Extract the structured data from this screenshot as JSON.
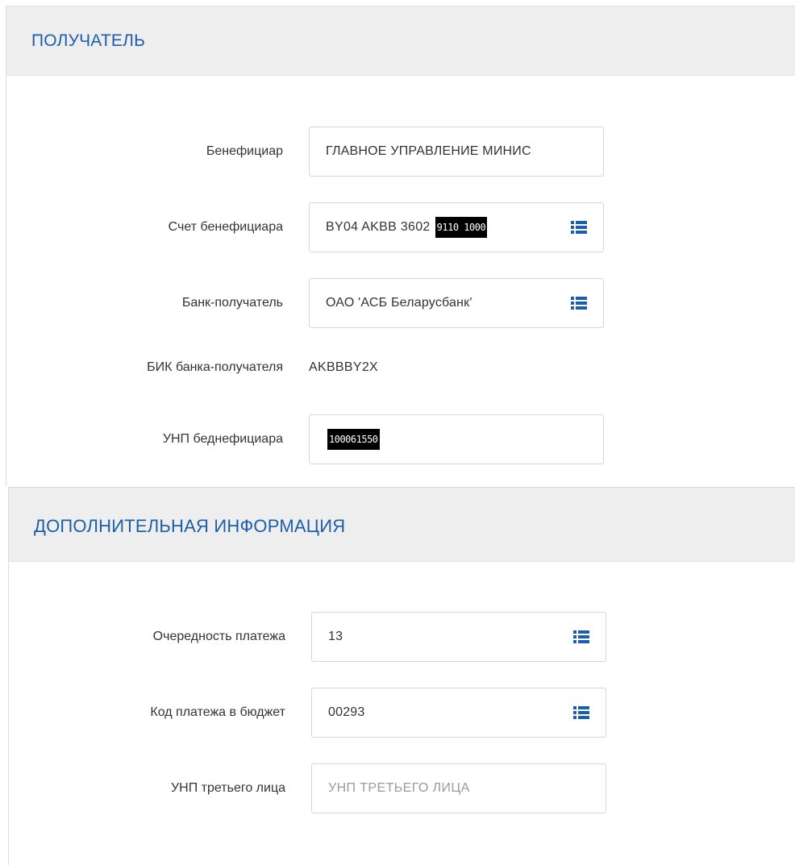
{
  "recipient_section": {
    "title": "ПОЛУЧАТЕЛЬ",
    "beneficiary": {
      "label": "Бенефициар",
      "value": "ГЛАВНОЕ УПРАВЛЕНИЕ МИНИС"
    },
    "beneficiary_account": {
      "label": "Счет бенефициара",
      "value_visible": "BY04 AKBB 3602",
      "value_redacted": "9110 1000",
      "icon": "list-icon"
    },
    "recipient_bank": {
      "label": "Банк-получатель",
      "value": "ОАО 'АСБ Беларусбанк'",
      "icon": "list-icon"
    },
    "recipient_bank_bic": {
      "label": "БИК банка-получателя",
      "value": "AKBBBY2X"
    },
    "beneficiary_unp": {
      "label": "УНП беднефициара",
      "value_redacted": "100061550"
    }
  },
  "additional_section": {
    "title": "ДОПОЛНИТЕЛЬНАЯ ИНФОРМАЦИЯ",
    "payment_priority": {
      "label": "Очередность платежа",
      "value": "13",
      "icon": "list-icon"
    },
    "budget_payment_code": {
      "label": "Код платежа в бюджет",
      "value": "00293",
      "icon": "list-icon"
    },
    "third_party_unp": {
      "label": "УНП третьего лица",
      "value": "",
      "placeholder": "УНП ТРЕТЬЕГО ЛИЦА"
    }
  },
  "colors": {
    "accent": "#1c5fa8",
    "icon": "#1c5fa8",
    "header_bg": "#eeeeee",
    "border": "#d6d6d6"
  }
}
